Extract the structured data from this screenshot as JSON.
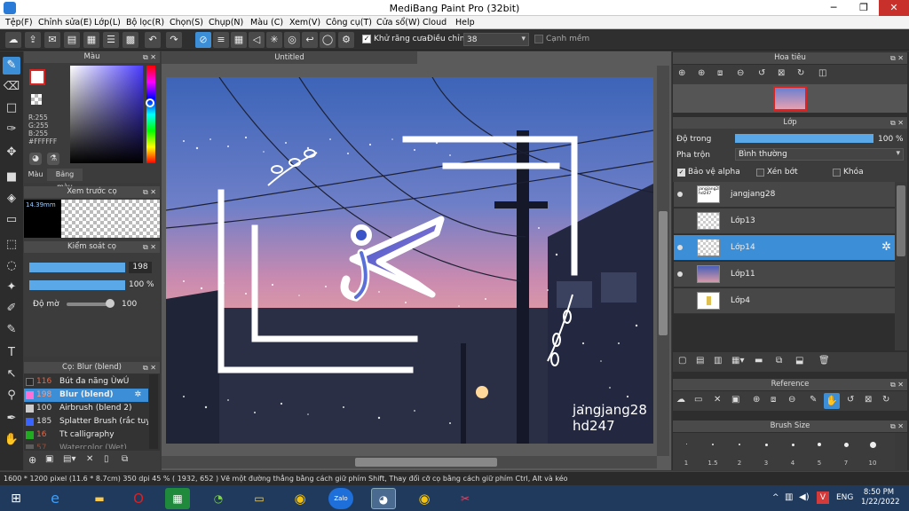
{
  "window": {
    "title": "MediBang Paint Pro (32bit)",
    "minimize": "─",
    "restore": "❐",
    "close": "✕"
  },
  "menu": [
    "Tệp(F)",
    "Chỉnh sửa(E)",
    "Lớp(L)",
    "Bộ lọc(R)",
    "Chọn(S)",
    "Chụp(N)",
    "Màu (C)",
    "Xem(V)",
    "Công cụ(T)",
    "Cửa sổ(W)",
    "Cloud",
    "Help"
  ],
  "toolbar": {
    "antialias_label": "Khử răng cưa",
    "adjust_label": "Điều chỉnh",
    "adjust_value": "38",
    "smooth_label": "Cạnh mềm"
  },
  "color_panel": {
    "title": "Màu",
    "r": "R:255",
    "g": "G:255",
    "b": "B:255",
    "hex": "#FFFFFF",
    "tab_color": "Màu",
    "tab_palette": "Bảng màu"
  },
  "brush_preview": {
    "title": "Xem trước cọ",
    "size": "14.39mm"
  },
  "brush_control": {
    "title": "Kiểm soát cọ",
    "size_value": "198",
    "opacity_value": "100 %",
    "blur_label": "Độ mờ",
    "blur_value": "100"
  },
  "brush_list": {
    "title": "Cọ: Blur (blend)",
    "items": [
      {
        "num": "116",
        "name": "Bút đa năng ÙwÚ",
        "color": "#2a2a2a"
      },
      {
        "num": "198",
        "name": "Blur (blend)",
        "color": "#ff6fd6"
      },
      {
        "num": "100",
        "name": "Airbrush (blend 2)",
        "color": "#cccccc"
      },
      {
        "num": "185",
        "name": "Splatter Brush (rắc tuyết)",
        "color": "#3a64ff"
      },
      {
        "num": "16",
        "name": "Tt calligraphy",
        "color": "#22aa22"
      },
      {
        "num": "57",
        "name": "Watercolor (Wet)",
        "color": "#888888"
      }
    ]
  },
  "canvas": {
    "tab": "Untitled",
    "signature_line1": "jangjang28",
    "signature_line2": "hd247"
  },
  "navigator": {
    "title": "Hoa tiêu"
  },
  "layer_panel": {
    "title": "Lớp",
    "opacity_label": "Độ trong",
    "opacity_value": "100 %",
    "blend_label": "Pha trộn",
    "blend_value": "Bình thường",
    "protect_alpha": "Bảo vệ alpha",
    "clipping": "Xén bớt",
    "lock": "Khóa",
    "layers": [
      {
        "name": "jangjang28",
        "thumb_text": "jangjang28 hd247",
        "selected": false
      },
      {
        "name": "Lớp13",
        "selected": false
      },
      {
        "name": "Lớp14",
        "selected": true
      },
      {
        "name": "Lớp11",
        "selected": false
      },
      {
        "name": "Lớp4",
        "selected": false
      }
    ]
  },
  "reference": {
    "title": "Reference"
  },
  "brush_size": {
    "title": "Brush Size",
    "sizes": [
      "1",
      "1.5",
      "2",
      "3",
      "4",
      "5",
      "7",
      "10"
    ]
  },
  "status": {
    "text": "1600 * 1200 pixel   (11.6 * 8.7cm)   350 dpi   45 %   ( 1932, 652 )   Vẽ một đường thẳng bằng cách giữ phím Shift, Thay đổi cỡ cọ bằng cách giữ phím Ctrl, Alt và kéo"
  },
  "taskbar": {
    "lang": "ENG",
    "time": "8:50 PM",
    "date": "1/22/2022"
  },
  "colors": {
    "accent": "#3c8fd7",
    "close": "#c8302c"
  }
}
